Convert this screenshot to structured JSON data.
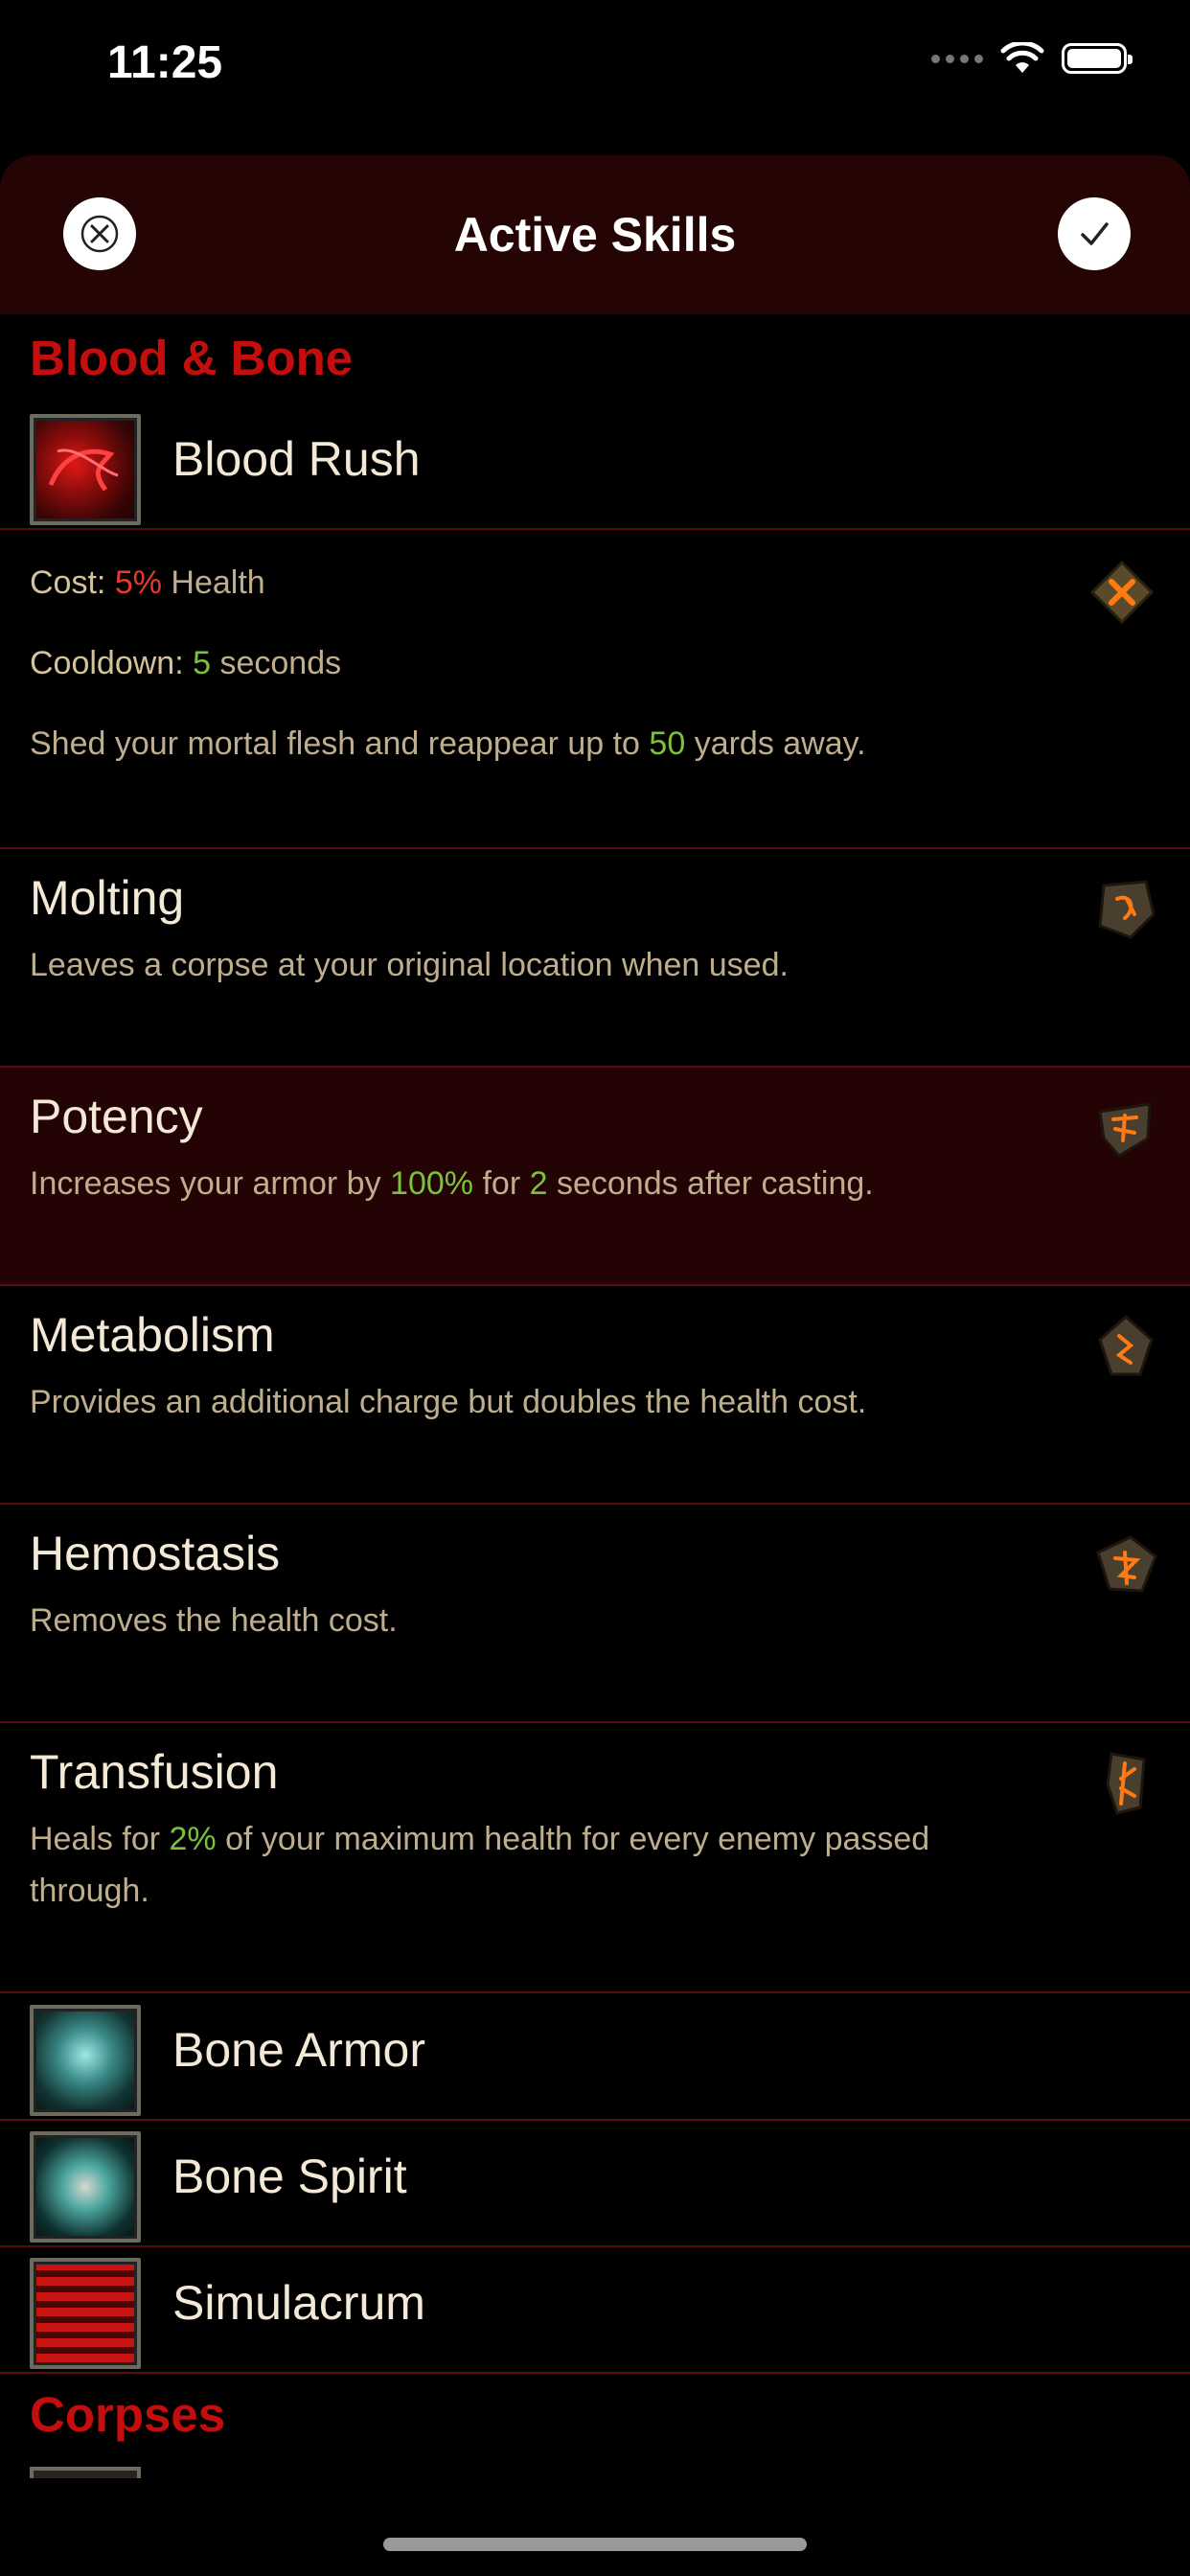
{
  "status_bar": {
    "time": "11:25"
  },
  "header": {
    "title": "Active Skills",
    "close_icon": "close-icon",
    "confirm_icon": "checkmark-icon"
  },
  "sections": [
    {
      "title": "Blood & Bone"
    },
    {
      "title": "Corpses"
    }
  ],
  "selected_skill": {
    "name": "Blood Rush",
    "cost_label": "Cost:",
    "cost_value": "5%",
    "cost_unit": "Health",
    "cooldown_label": "Cooldown:",
    "cooldown_value": "5",
    "cooldown_unit": "seconds",
    "description_pre": "Shed your mortal flesh and reappear up to",
    "description_value": "50",
    "description_post": "yards away.",
    "clear_rune_icon": "clear-rune-icon"
  },
  "runes": [
    {
      "name": "Molting",
      "description": "Leaves a corpse at your original location when used.",
      "icon": "rune-icon"
    },
    {
      "name": "Potency",
      "desc_parts": [
        "Increases your armor by",
        "100%",
        "for",
        "2",
        "seconds after casting."
      ],
      "selected": true,
      "icon": "rune-icon"
    },
    {
      "name": "Metabolism",
      "description": "Provides an additional charge but doubles the health cost.",
      "icon": "rune-icon"
    },
    {
      "name": "Hemostasis",
      "description": "Removes the health cost.",
      "icon": "rune-icon"
    },
    {
      "name": "Transfusion",
      "desc_parts": [
        "Heals for",
        "2%",
        "of your maximum health for every enemy passed through."
      ],
      "icon": "rune-icon"
    }
  ],
  "other_skills": [
    {
      "name": "Bone Armor"
    },
    {
      "name": "Bone Spirit"
    },
    {
      "name": "Simulacrum"
    }
  ],
  "colors": {
    "accent_red": "#c40d0d",
    "highlight_green": "#7cc13c",
    "header_bg": "#250404",
    "divider": "#5a0b12"
  }
}
